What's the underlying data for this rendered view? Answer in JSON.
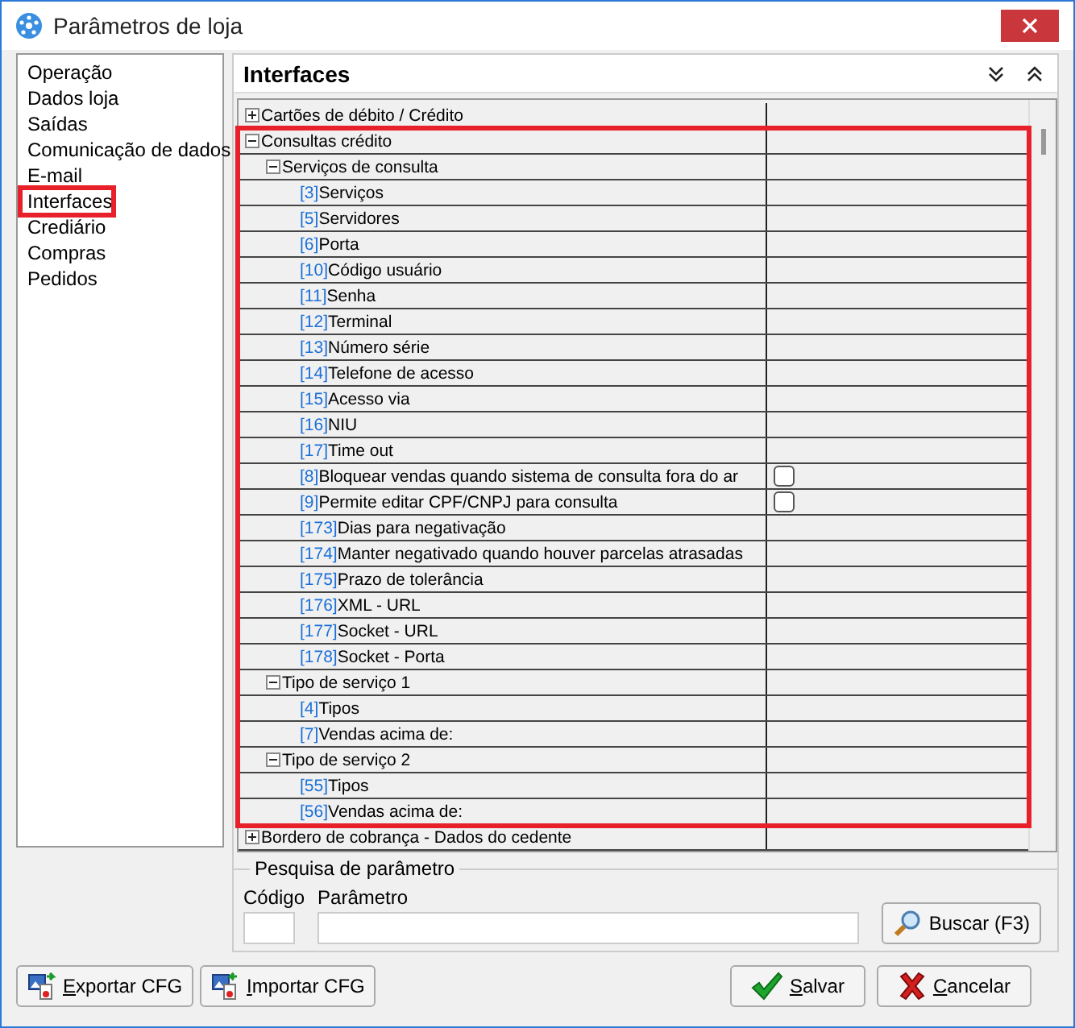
{
  "window": {
    "title": "Parâmetros de loja"
  },
  "sidebar": {
    "items": [
      {
        "label": "Operação",
        "highlighted": false
      },
      {
        "label": "Dados loja",
        "highlighted": false
      },
      {
        "label": "Saídas",
        "highlighted": false
      },
      {
        "label": "Comunicação de dados",
        "highlighted": false
      },
      {
        "label": "E-mail",
        "highlighted": false
      },
      {
        "label": "Interfaces",
        "highlighted": true
      },
      {
        "label": "Crediário",
        "highlighted": false
      },
      {
        "label": "Compras",
        "highlighted": false
      },
      {
        "label": "Pedidos",
        "highlighted": false
      }
    ]
  },
  "panel": {
    "title": "Interfaces"
  },
  "grid": {
    "items": [
      {
        "label": "Cartões de débito / Crédito",
        "expanded": false,
        "highlighted": false
      },
      {
        "label": "Consultas crédito",
        "expanded": true,
        "highlighted": true,
        "children": [
          {
            "label": "Serviços de consulta",
            "expanded": true,
            "children": [
              {
                "code": "[3]",
                "label": "Serviços",
                "kind": "text"
              },
              {
                "code": "[5]",
                "label": "Servidores",
                "kind": "text"
              },
              {
                "code": "[6]",
                "label": "Porta",
                "kind": "text"
              },
              {
                "code": "[10]",
                "label": "Código usuário",
                "kind": "text"
              },
              {
                "code": "[11]",
                "label": "Senha",
                "kind": "text"
              },
              {
                "code": "[12]",
                "label": "Terminal",
                "kind": "text"
              },
              {
                "code": "[13]",
                "label": "Número série",
                "kind": "text"
              },
              {
                "code": "[14]",
                "label": "Telefone de acesso",
                "kind": "text"
              },
              {
                "code": "[15]",
                "label": "Acesso via",
                "kind": "text"
              },
              {
                "code": "[16]",
                "label": "NIU",
                "kind": "text"
              },
              {
                "code": "[17]",
                "label": "Time out",
                "kind": "text"
              },
              {
                "code": "[8]",
                "label": "Bloquear vendas quando sistema de consulta fora do ar",
                "kind": "checkbox",
                "checked": false
              },
              {
                "code": "[9]",
                "label": "Permite editar CPF/CNPJ para consulta",
                "kind": "checkbox",
                "checked": false
              },
              {
                "code": "[173]",
                "label": "Dias para negativação",
                "kind": "text"
              },
              {
                "code": "[174]",
                "label": "Manter negativado quando houver parcelas atrasadas",
                "kind": "text"
              },
              {
                "code": "[175]",
                "label": "Prazo de tolerância",
                "kind": "text"
              },
              {
                "code": "[176]",
                "label": "XML - URL",
                "kind": "text"
              },
              {
                "code": "[177]",
                "label": "Socket - URL",
                "kind": "text"
              },
              {
                "code": "[178]",
                "label": "Socket - Porta",
                "kind": "text"
              }
            ]
          },
          {
            "label": "Tipo de serviço 1",
            "expanded": true,
            "children": [
              {
                "code": "[4]",
                "label": "Tipos",
                "kind": "text"
              },
              {
                "code": "[7]",
                "label": "Vendas acima de:",
                "kind": "text"
              }
            ]
          },
          {
            "label": "Tipo de serviço 2",
            "expanded": true,
            "children": [
              {
                "code": "[55]",
                "label": "Tipos",
                "kind": "text"
              },
              {
                "code": "[56]",
                "label": "Vendas acima de:",
                "kind": "text"
              }
            ]
          }
        ]
      },
      {
        "label": "Bordero de cobrança - Dados do cedente",
        "expanded": false,
        "highlighted": false
      }
    ]
  },
  "search": {
    "title": "Pesquisa de parâmetro",
    "code_label": "Código",
    "param_label": "Parâmetro",
    "button": "Buscar (F3)"
  },
  "buttons": [
    {
      "label": "Exportar CFG",
      "kind": "export"
    },
    {
      "label": "Importar CFG",
      "kind": "import"
    },
    {
      "label": "Salvar",
      "kind": "save"
    },
    {
      "label": "Cancelar",
      "kind": "cancel"
    }
  ]
}
